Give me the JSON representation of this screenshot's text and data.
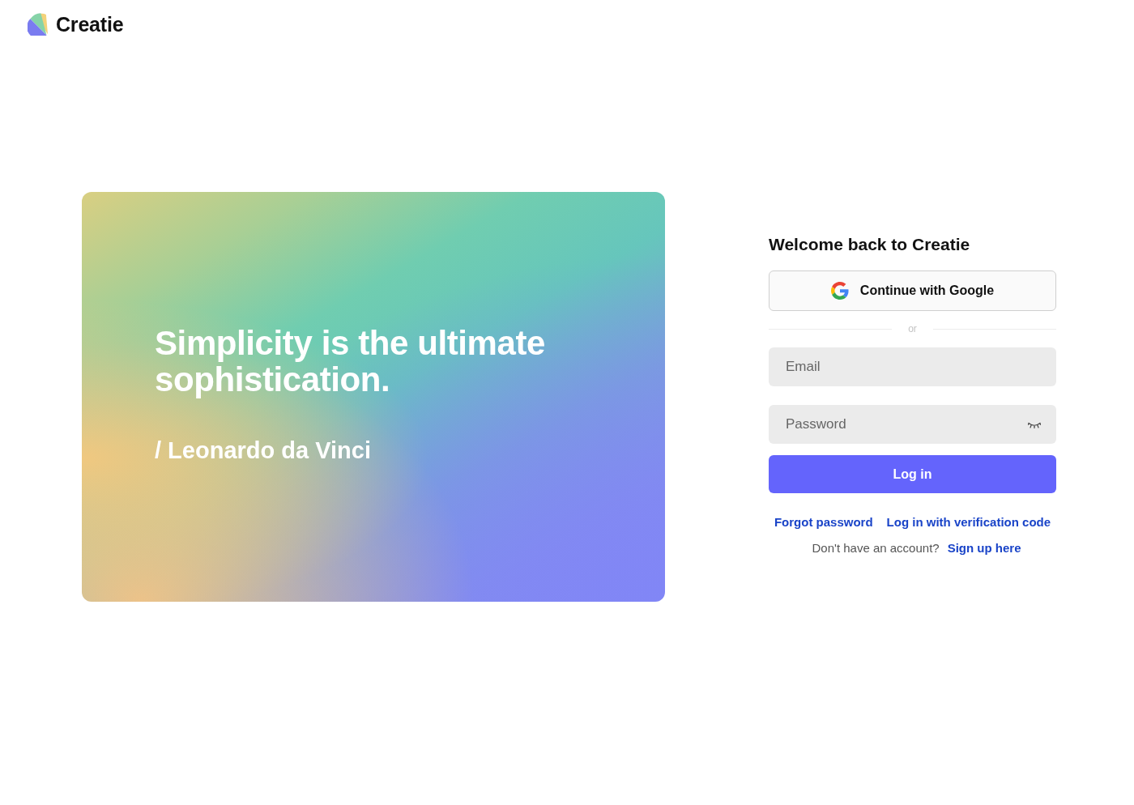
{
  "logo": {
    "name": "Creatie"
  },
  "hero": {
    "quote": "Simplicity is the ultimate sophistication.",
    "author": "/ Leonardo da Vinci"
  },
  "login": {
    "title": "Welcome back to Creatie",
    "google_button": "Continue with Google",
    "divider": "or",
    "email": {
      "placeholder": "Email"
    },
    "password": {
      "placeholder": "Password",
      "visible": false
    },
    "submit": "Log in",
    "links": [
      "Forgot password",
      "Log in with verification code"
    ],
    "signup": {
      "prompt": "Don't have an account?",
      "link": "Sign up here"
    }
  }
}
